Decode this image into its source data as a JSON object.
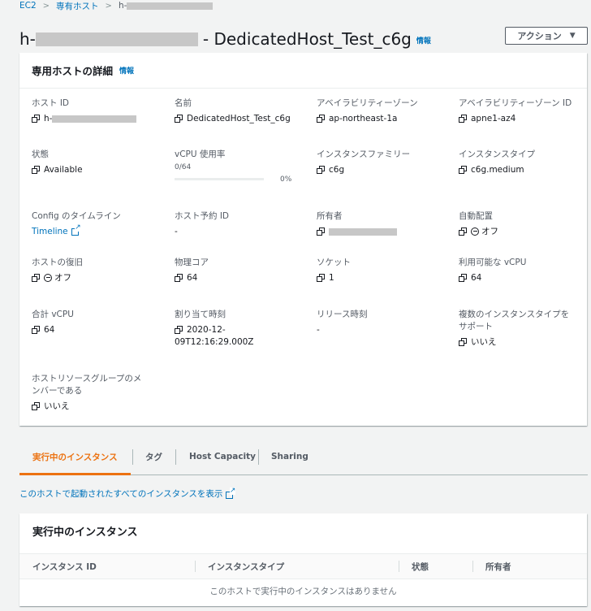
{
  "breadcrumb": {
    "root": "EC2",
    "section": "専有ホスト",
    "current_prefix": "h-"
  },
  "header": {
    "title_prefix": "h-",
    "title_suffix": "- DedicatedHost_Test_c6g",
    "info_label": "情報",
    "action_label": "アクション"
  },
  "details": {
    "title": "専用ホストの詳細",
    "info_label": "情報",
    "fields": {
      "host_id": {
        "label": "ホスト ID",
        "value_prefix": "h-"
      },
      "name": {
        "label": "名前",
        "value": "DedicatedHost_Test_c6g"
      },
      "az": {
        "label": "アベイラビリティーゾーン",
        "value": "ap-northeast-1a"
      },
      "az_id": {
        "label": "アベイラビリティーゾーン ID",
        "value": "apne1-az4"
      },
      "state": {
        "label": "状態",
        "value": "Available"
      },
      "vcpu_usage": {
        "label": "vCPU 使用率",
        "count": "0/64",
        "percent": "0%",
        "fraction": 0
      },
      "family": {
        "label": "インスタンスファミリー",
        "value": "c6g"
      },
      "type": {
        "label": "インスタンスタイプ",
        "value": "c6g.medium"
      },
      "config_timeline": {
        "label": "Config のタイムライン",
        "value": "Timeline"
      },
      "reservation": {
        "label": "ホスト予約 ID",
        "value": "-"
      },
      "owner": {
        "label": "所有者"
      },
      "auto_placement": {
        "label": "自動配置",
        "value": "オフ"
      },
      "host_recovery": {
        "label": "ホストの復旧",
        "value": "オフ"
      },
      "cores": {
        "label": "物理コア",
        "value": "64"
      },
      "sockets": {
        "label": "ソケット",
        "value": "1"
      },
      "available_vcpu": {
        "label": "利用可能な vCPU",
        "value": "64"
      },
      "total_vcpu": {
        "label": "合計 vCPU",
        "value": "64"
      },
      "allocation_time": {
        "label": "割り当て時刻",
        "value_line1": "2020-12-",
        "value_line2": "09T12:16:29.000Z"
      },
      "release_time": {
        "label": "リリース時刻",
        "value": "-"
      },
      "multi_type": {
        "label_line1": "複数のインスタンスタイプを",
        "label_line2": "サポート",
        "value": "いいえ"
      },
      "resource_group": {
        "label_line1": "ホストリソースグループのメ",
        "label_line2": "ンバーである",
        "value": "いいえ"
      }
    }
  },
  "tabs": [
    {
      "label": "実行中のインスタンス",
      "active": true
    },
    {
      "label": "タグ"
    },
    {
      "label": "Host Capacity"
    },
    {
      "label": "Sharing"
    }
  ],
  "all_instances_link": "このホストで起動されたすべてのインスタンスを表示",
  "instances": {
    "title": "実行中のインスタンス",
    "columns": [
      "インスタンス ID",
      "インスタンスタイプ",
      "状態",
      "所有者"
    ],
    "empty_message": "このホストで実行中のインスタンスはありません"
  }
}
